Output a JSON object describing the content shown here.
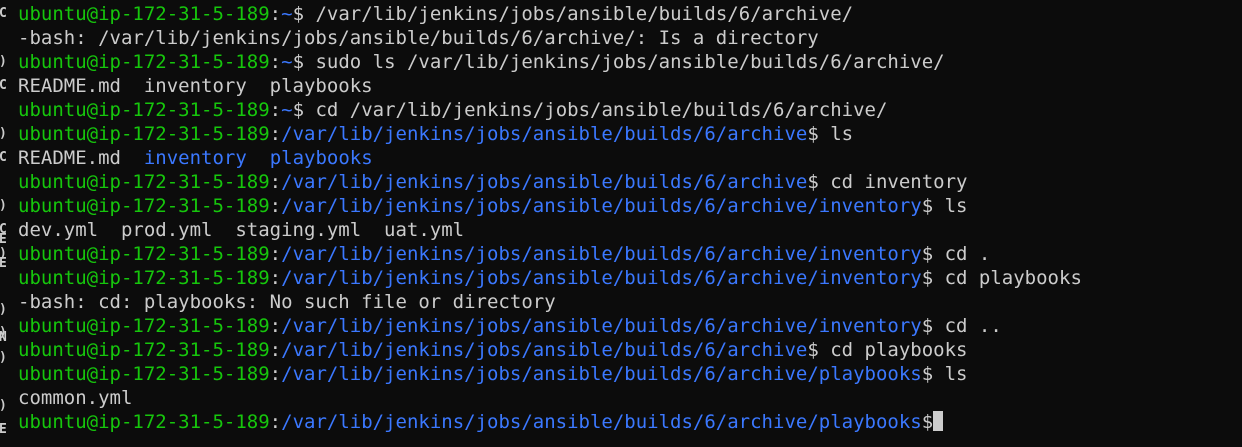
{
  "terminal": {
    "gutter_glyphs": [
      "C",
      ")",
      "C",
      ")",
      "C",
      ")",
      "C",
      ")",
      "E",
      "E",
      ")",
      ")",
      "N",
      ")",
      ")",
      "E"
    ],
    "lines": [
      {
        "type": "prompt",
        "user": "ubuntu@ip-172-31-5-189",
        "sep": ":",
        "path": "~",
        "symbol": "$",
        "cmd": " /var/lib/jenkins/jobs/ansible/builds/6/archive/"
      },
      {
        "type": "output",
        "text": "-bash: /var/lib/jenkins/jobs/ansible/builds/6/archive/: Is a directory"
      },
      {
        "type": "prompt",
        "user": "ubuntu@ip-172-31-5-189",
        "sep": ":",
        "path": "~",
        "symbol": "$",
        "cmd": " sudo ls /var/lib/jenkins/jobs/ansible/builds/6/archive/"
      },
      {
        "type": "output",
        "text": "README.md  inventory  playbooks"
      },
      {
        "type": "prompt",
        "user": "ubuntu@ip-172-31-5-189",
        "sep": ":",
        "path": "~",
        "symbol": "$",
        "cmd": " cd /var/lib/jenkins/jobs/ansible/builds/6/archive/"
      },
      {
        "type": "prompt",
        "user": "ubuntu@ip-172-31-5-189",
        "sep": ":",
        "path": "/var/lib/jenkins/jobs/ansible/builds/6/archive",
        "symbol": "$",
        "cmd": " ls"
      },
      {
        "type": "ls",
        "items": [
          {
            "text": "README.md",
            "kind": "file"
          },
          {
            "text": "  ",
            "kind": "space"
          },
          {
            "text": "inventory",
            "kind": "dir"
          },
          {
            "text": "  ",
            "kind": "space"
          },
          {
            "text": "playbooks",
            "kind": "dir"
          }
        ]
      },
      {
        "type": "prompt",
        "user": "ubuntu@ip-172-31-5-189",
        "sep": ":",
        "path": "/var/lib/jenkins/jobs/ansible/builds/6/archive",
        "symbol": "$",
        "cmd": " cd inventory"
      },
      {
        "type": "prompt",
        "user": "ubuntu@ip-172-31-5-189",
        "sep": ":",
        "path": "/var/lib/jenkins/jobs/ansible/builds/6/archive/inventory",
        "symbol": "$",
        "cmd": " ls"
      },
      {
        "type": "output",
        "text": "dev.yml  prod.yml  staging.yml  uat.yml"
      },
      {
        "type": "prompt",
        "user": "ubuntu@ip-172-31-5-189",
        "sep": ":",
        "path": "/var/lib/jenkins/jobs/ansible/builds/6/archive/inventory",
        "symbol": "$",
        "cmd": " cd ."
      },
      {
        "type": "prompt",
        "user": "ubuntu@ip-172-31-5-189",
        "sep": ":",
        "path": "/var/lib/jenkins/jobs/ansible/builds/6/archive/inventory",
        "symbol": "$",
        "cmd": " cd playbooks"
      },
      {
        "type": "output",
        "text": "-bash: cd: playbooks: No such file or directory"
      },
      {
        "type": "prompt",
        "user": "ubuntu@ip-172-31-5-189",
        "sep": ":",
        "path": "/var/lib/jenkins/jobs/ansible/builds/6/archive/inventory",
        "symbol": "$",
        "cmd": " cd .."
      },
      {
        "type": "prompt",
        "user": "ubuntu@ip-172-31-5-189",
        "sep": ":",
        "path": "/var/lib/jenkins/jobs/ansible/builds/6/archive",
        "symbol": "$",
        "cmd": " cd playbooks"
      },
      {
        "type": "prompt",
        "user": "ubuntu@ip-172-31-5-189",
        "sep": ":",
        "path": "/var/lib/jenkins/jobs/ansible/builds/6/archive/playbooks",
        "symbol": "$",
        "cmd": " ls"
      },
      {
        "type": "output",
        "text": "common.yml"
      },
      {
        "type": "prompt",
        "user": "ubuntu@ip-172-31-5-189",
        "sep": ":",
        "path": "/var/lib/jenkins/jobs/ansible/builds/6/archive/playbooks",
        "symbol": "$",
        "cmd": "",
        "cursor": true
      }
    ]
  },
  "colors": {
    "background": "#0c0c0c",
    "user": "#16c60c",
    "path": "#3b78ff",
    "text": "#cccccc"
  }
}
